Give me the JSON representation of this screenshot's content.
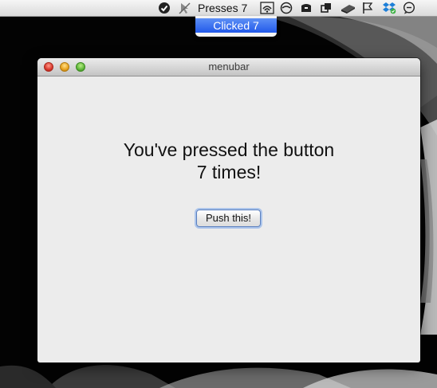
{
  "menubar": {
    "status_text": "Presses 7",
    "icons": [
      "system-shield-icon",
      "cursor-slash-icon",
      "wifi-icon",
      "sync-circle-icon",
      "box-icon",
      "crop-icon",
      "cube-icon",
      "flag-icon",
      "dropbox-icon",
      "chat-bubble-icon"
    ]
  },
  "status_menu": {
    "item_label": "Clicked 7"
  },
  "window": {
    "title": "menubar",
    "message_line1": "You've pressed the button",
    "message_line2": "7 times!",
    "button_label": "Push this!"
  }
}
